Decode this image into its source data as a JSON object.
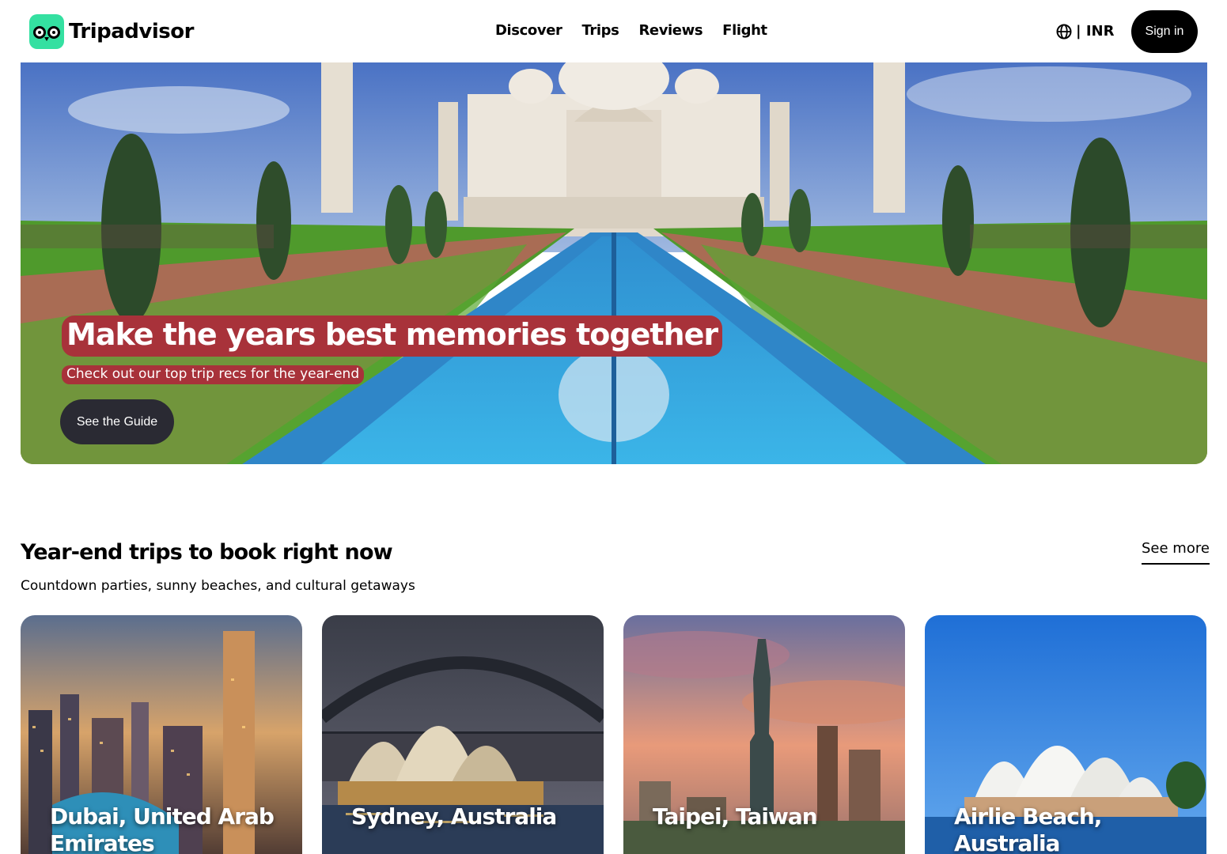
{
  "header": {
    "brand": "Tripadvisor",
    "nav": [
      "Discover",
      "Trips",
      "Reviews",
      "Flight"
    ],
    "currency": "| INR",
    "signin": "Sign in"
  },
  "hero": {
    "title": "Make the years best memories together",
    "subtitle": "Check out our top trip recs for the year-end",
    "button": "See the Guide"
  },
  "section": {
    "title": "Year-end trips to book right now",
    "subtitle": "Countdown parties, sunny beaches, and cultural getaways",
    "see_more": "See more",
    "cards": [
      {
        "label": "Dubai, United Arab Emirates"
      },
      {
        "label": "Sydney, Australia"
      },
      {
        "label": "Taipei, Taiwan"
      },
      {
        "label": "Airlie Beach, Australia"
      }
    ]
  },
  "colors": {
    "brand_green": "#34e0a1",
    "hero_label_bg": "#a8323a",
    "button_dark": "#2a2a33"
  }
}
